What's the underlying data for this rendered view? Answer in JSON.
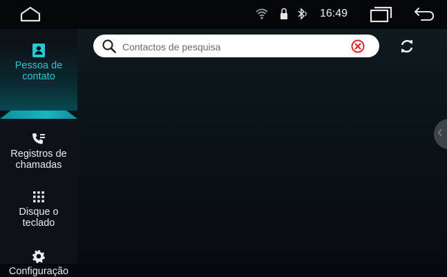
{
  "status_bar": {
    "time": "16:49",
    "icons": [
      "home-icon",
      "wifi-icon",
      "lock-icon",
      "bluetooth-icon",
      "recents-icon",
      "back-icon"
    ]
  },
  "sidebar": {
    "items": [
      {
        "label": "Pessoa de contato",
        "icon": "contact-card-icon",
        "active": true
      },
      {
        "label": "Registros de chamadas",
        "icon": "call-log-icon",
        "active": false
      },
      {
        "label": "Disque o teclado",
        "icon": "dialpad-icon",
        "active": false
      },
      {
        "label": "Configuração",
        "icon": "gear-icon",
        "active": false
      }
    ]
  },
  "search": {
    "placeholder": "Contactos de pesquisa",
    "value": ""
  },
  "colors": {
    "accent": "#27c7d6",
    "clear_button": "#e0242f",
    "background": "#05080d"
  }
}
